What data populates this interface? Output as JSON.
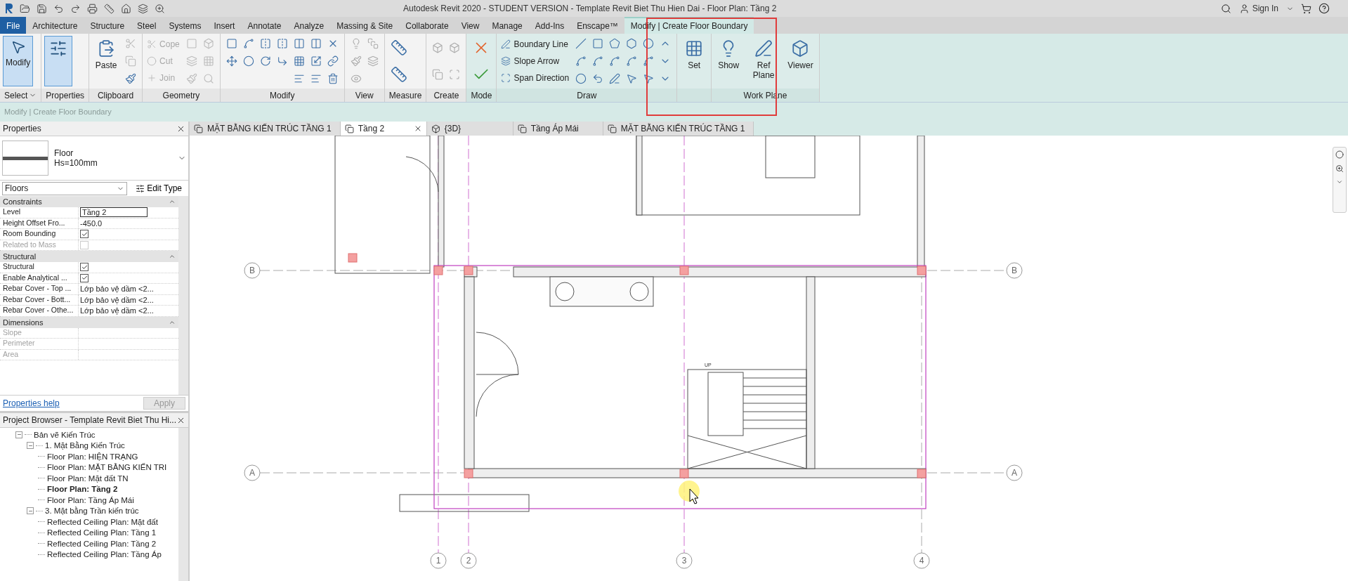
{
  "window": {
    "title": "Autodesk Revit 2020 - STUDENT VERSION - Template Revit Biet Thu Hien Dai - Floor Plan: Tầng 2",
    "sign_in": "Sign In"
  },
  "ribbon_tabs": [
    {
      "label": "File",
      "kind": "file",
      "selected": false
    },
    {
      "label": "Architecture",
      "kind": "tab",
      "selected": false
    },
    {
      "label": "Structure",
      "kind": "tab",
      "selected": false
    },
    {
      "label": "Steel",
      "kind": "tab",
      "selected": false
    },
    {
      "label": "Systems",
      "kind": "tab",
      "selected": false
    },
    {
      "label": "Insert",
      "kind": "tab",
      "selected": false
    },
    {
      "label": "Annotate",
      "kind": "tab",
      "selected": false
    },
    {
      "label": "Analyze",
      "kind": "tab",
      "selected": false
    },
    {
      "label": "Massing & Site",
      "kind": "tab",
      "selected": false
    },
    {
      "label": "Collaborate",
      "kind": "tab",
      "selected": false
    },
    {
      "label": "View",
      "kind": "tab",
      "selected": false
    },
    {
      "label": "Manage",
      "kind": "tab",
      "selected": false
    },
    {
      "label": "Add-Ins",
      "kind": "tab",
      "selected": false
    },
    {
      "label": "Enscape™",
      "kind": "tab",
      "selected": false
    },
    {
      "label": "Modify | Create Floor Boundary",
      "kind": "context",
      "selected": true
    }
  ],
  "ribbon_groups": [
    {
      "kind": "select",
      "label": "Select",
      "large": [
        {
          "label": "Modify",
          "selected": true
        }
      ]
    },
    {
      "kind": "properties",
      "label": "Properties",
      "large": [
        {
          "selected": true
        }
      ]
    },
    {
      "kind": "clipboard",
      "label": "Clipboard",
      "large": [
        {
          "label": "Paste",
          "selected": false
        }
      ]
    },
    {
      "kind": "geometry",
      "label": "Geometry",
      "small": [
        {
          "label": "Cope",
          "disabled": true
        },
        {
          "label": "Cut",
          "disabled": true
        },
        {
          "label": "Join",
          "disabled": true
        }
      ]
    },
    {
      "kind": "modify",
      "label": "Modify"
    },
    {
      "kind": "view",
      "label": "View"
    },
    {
      "kind": "measure",
      "label": "Measure"
    },
    {
      "kind": "create",
      "label": "Create"
    },
    {
      "kind": "mode",
      "label": "Mode"
    },
    {
      "kind": "draw",
      "label": "Draw",
      "small": [
        {
          "label": "Boundary Line",
          "disabled": false
        },
        {
          "label": "Slope Arrow",
          "disabled": false
        },
        {
          "label": "Span Direction",
          "disabled": false
        }
      ]
    },
    {
      "kind": "set",
      "large": [
        {
          "label": "Set",
          "selected": false
        }
      ]
    },
    {
      "kind": "workplane",
      "label": "Work Plane",
      "large": [
        {
          "label": "Show",
          "selected": false
        },
        {
          "label": "Ref Plane",
          "selected": false
        },
        {
          "label": "Viewer",
          "selected": false
        }
      ]
    }
  ],
  "context_bar": "Modify | Create Floor Boundary",
  "properties": {
    "title": "Properties",
    "type_name": "Floor",
    "type_detail": "Hs=100mm",
    "category": "Floors",
    "edit_type": "Edit Type",
    "sections": [
      {
        "title": "Constraints",
        "rows": [
          {
            "label": "Level",
            "kind": "field",
            "value": "Tầng 2",
            "disabled": false
          },
          {
            "label": "Height Offset Fro...",
            "kind": "text",
            "value": "-450.0",
            "disabled": false
          },
          {
            "label": "Room Bounding",
            "kind": "check",
            "checked": true,
            "disabled": false
          },
          {
            "label": "Related to Mass",
            "kind": "check",
            "checked": false,
            "disabled": true
          }
        ]
      },
      {
        "title": "Structural",
        "rows": [
          {
            "label": "Structural",
            "kind": "check",
            "checked": true,
            "disabled": false
          },
          {
            "label": "Enable Analytical ...",
            "kind": "check",
            "checked": true,
            "disabled": false
          },
          {
            "label": "Rebar Cover - Top ...",
            "kind": "text",
            "value": "Lớp bảo vệ dầm <2...",
            "disabled": false
          },
          {
            "label": "Rebar Cover - Bott...",
            "kind": "text",
            "value": "Lớp bảo vệ dầm <2...",
            "disabled": false
          },
          {
            "label": "Rebar Cover - Othe...",
            "kind": "text",
            "value": "Lớp bảo vệ dầm <2...",
            "disabled": false
          }
        ]
      },
      {
        "title": "Dimensions",
        "rows": [
          {
            "label": "Slope",
            "kind": "text",
            "disabled": true
          },
          {
            "label": "Perimeter",
            "kind": "text",
            "disabled": true
          },
          {
            "label": "Area",
            "kind": "text",
            "disabled": true
          }
        ]
      }
    ],
    "help": "Properties help",
    "apply": "Apply"
  },
  "project_browser": {
    "title": "Project Browser - Template Revit Biet Thu Hi...",
    "tree": [
      {
        "label": "Bản vẽ Kiến Trúc",
        "expanded": true,
        "selected": false,
        "children": [
          {
            "label": "1. Mặt Bằng Kiến Trúc",
            "expanded": true,
            "selected": false,
            "children": [
              {
                "label": "Floor Plan: HIỆN TRẠNG",
                "selected": false
              },
              {
                "label": "Floor Plan: MẶT BẰNG KIẾN TRI",
                "selected": false
              },
              {
                "label": "Floor Plan: Mặt đất TN",
                "selected": false
              },
              {
                "label": "Floor Plan: Tầng 2",
                "selected": true
              },
              {
                "label": "Floor Plan: Tầng Áp Mái",
                "selected": false
              }
            ]
          },
          {
            "label": "3. Mặt bằng Trần kiến trúc",
            "expanded": true,
            "selected": false,
            "children": [
              {
                "label": "Reflected Ceiling Plan: Mặt đất",
                "selected": false
              },
              {
                "label": "Reflected Ceiling Plan: Tầng 1",
                "selected": false
              },
              {
                "label": "Reflected Ceiling Plan: Tầng 2",
                "selected": false
              },
              {
                "label": "Reflected Ceiling Plan: Tầng Áp",
                "selected": false
              }
            ]
          }
        ]
      }
    ]
  },
  "view_tabs": [
    {
      "label": "MẶT BẰNG KIẾN TRÚC TẦNG 1",
      "kind": "plan",
      "selected": false
    },
    {
      "label": "Tầng 2",
      "kind": "plan",
      "selected": true
    },
    {
      "label": "{3D}",
      "kind": "model",
      "selected": false
    },
    {
      "label": "Tầng Áp Mái",
      "kind": "plan",
      "selected": false
    },
    {
      "label": "MẶT BẰNG KIẾN TRÚC TẦNG 1",
      "kind": "plan",
      "selected": false
    }
  ],
  "canvas": {
    "row_grids": [
      {
        "left": "B",
        "right": "B"
      },
      {
        "left": "A",
        "right": "A"
      }
    ],
    "column_grids": [
      "1",
      "2",
      "3",
      "4"
    ],
    "stair_label": "UP"
  }
}
